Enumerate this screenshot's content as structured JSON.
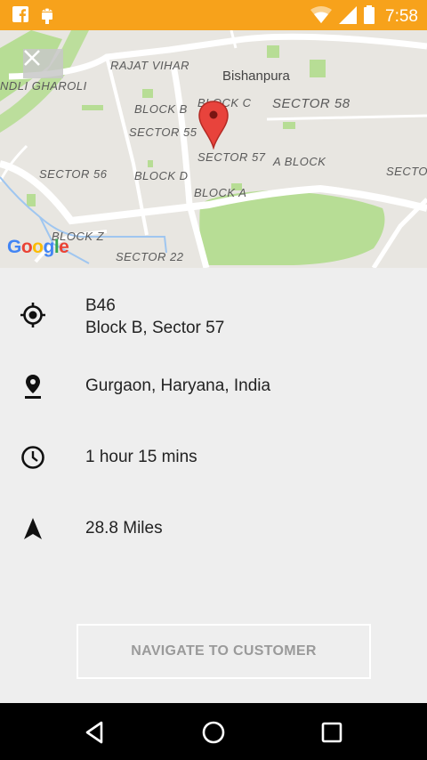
{
  "status_bar": {
    "time": "7:58",
    "left_icons": [
      "facebook-icon",
      "android-debug-icon"
    ],
    "right_icons": [
      "wifi-icon",
      "cell-signal-icon",
      "battery-icon"
    ],
    "color": "#f7a21b"
  },
  "map": {
    "labels": {
      "rajat_vihar": "RAJAT VIHAR",
      "bishanpura": "Bishanpura",
      "ndli_gharoli": "NDLI GHAROLI",
      "block_b": "BLOCK B",
      "block_c": "BLOCK C",
      "sector_58": "SECTOR 58",
      "sector_55": "SECTOR 55",
      "sector_57": "SECTOR 57",
      "a_block": "A BLOCK",
      "sector_right": "SECTO",
      "sector_56": "SECTOR 56",
      "block_d": "BLOCK D",
      "block_a": "BLOCK A",
      "block_z": "BLOCK Z",
      "sector_22": "SECTOR 22"
    },
    "logo": "Google"
  },
  "info": {
    "address_line1": "B46",
    "address_line2": "Block B, Sector 57",
    "city": "Gurgaon, Haryana, India",
    "duration": "1 hour 15 mins",
    "distance": "28.8 Miles"
  },
  "button": {
    "label": "NAVIGATE TO CUSTOMER"
  },
  "nav_bar": [
    "back-icon",
    "home-icon",
    "recents-icon"
  ]
}
